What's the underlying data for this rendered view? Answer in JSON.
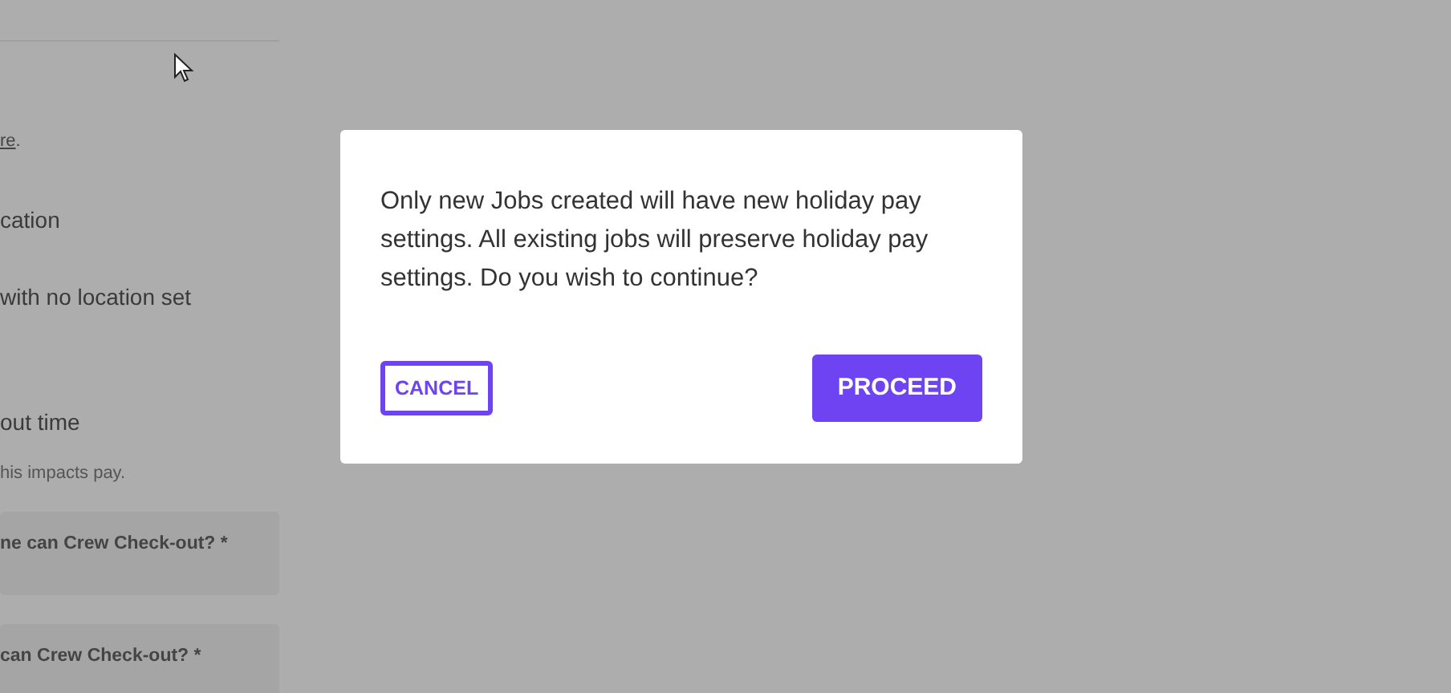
{
  "page": {
    "link_fragment": "re",
    "link_suffix": ".",
    "lines": [
      {
        "kind": "heading",
        "text": "cation"
      },
      {
        "kind": "heading",
        "text": "with no location set"
      },
      {
        "kind": "heading",
        "text": "out time"
      },
      {
        "kind": "hint",
        "text": "his impacts pay."
      },
      {
        "kind": "field",
        "text": "ne can Crew Check-out? *"
      },
      {
        "kind": "field",
        "text": "can Crew Check-out? *"
      }
    ]
  },
  "dialog": {
    "message": "Only new Jobs created will have new holiday pay settings. All existing jobs will preserve holiday pay settings. Do you wish to continue?",
    "buttons": [
      {
        "label": "CANCEL",
        "kind": "outline"
      },
      {
        "label": "PROCEED",
        "kind": "filled"
      }
    ]
  }
}
